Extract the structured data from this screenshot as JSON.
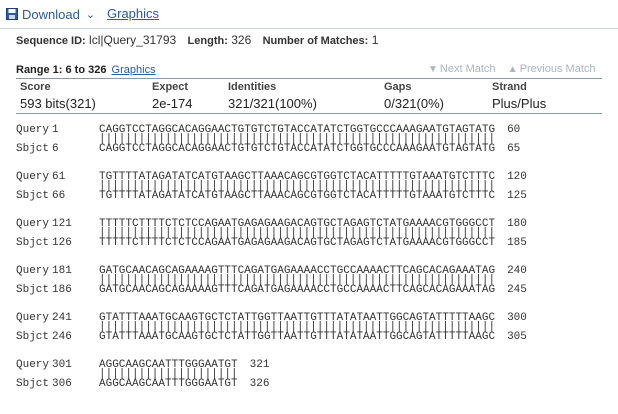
{
  "toolbar": {
    "download_label": "Download",
    "graphics_label": "Graphics"
  },
  "sequence": {
    "id_label": "Sequence ID:",
    "id_value": "lcl|Query_31793",
    "length_label": "Length:",
    "length_value": "326",
    "matches_label": "Number of Matches:",
    "matches_value": "1"
  },
  "range": {
    "label": "Range 1: 6 to 326",
    "graphics_link": "Graphics"
  },
  "nav": {
    "next_label": "Next Match",
    "prev_label": "Previous Match"
  },
  "stats": {
    "score_h": "Score",
    "score_v": "593 bits(321)",
    "expect_h": "Expect",
    "expect_v": "2e-174",
    "ident_h": "Identities",
    "ident_v": "321/321(100%)",
    "gaps_h": "Gaps",
    "gaps_v": "0/321(0%)",
    "strand_h": "Strand",
    "strand_v": "Plus/Plus"
  },
  "alignment": [
    {
      "q_label": "Query",
      "q_start": "1",
      "q_seq": "CAGGTCCTAGGCACAGGAACTGTGTCTGTACCATATCTGGTGCCCAAAGAATGTAGTATG",
      "q_end": "60",
      "match": "||||||||||||||||||||||||||||||||||||||||||||||||||||||||||||",
      "s_label": "Sbjct",
      "s_start": "6",
      "s_seq": "CAGGTCCTAGGCACAGGAACTGTGTCTGTACCATATCTGGTGCCCAAAGAATGTAGTATG",
      "s_end": "65"
    },
    {
      "q_label": "Query",
      "q_start": "61",
      "q_seq": "TGTTTTATAGATATCATGTAAGCTTAAACAGCGTGGTCTACATTTTTGTAAATGTCTTTC",
      "q_end": "120",
      "match": "||||||||||||||||||||||||||||||||||||||||||||||||||||||||||||",
      "s_label": "Sbjct",
      "s_start": "66",
      "s_seq": "TGTTTTATAGATATCATGTAAGCTTAAACAGCGTGGTCTACATTTTTGTAAATGTCTTTC",
      "s_end": "125"
    },
    {
      "q_label": "Query",
      "q_start": "121",
      "q_seq": "TTTTTCTTTTCTCTCCAGAATGAGAGAAGACAGTGCTAGAGTCTATGAAAACGTGGGCCT",
      "q_end": "180",
      "match": "||||||||||||||||||||||||||||||||||||||||||||||||||||||||||||",
      "s_label": "Sbjct",
      "s_start": "126",
      "s_seq": "TTTTTCTTTTCTCTCCAGAATGAGAGAAGACAGTGCTAGAGTCTATGAAAACGTGGGCCT",
      "s_end": "185"
    },
    {
      "q_label": "Query",
      "q_start": "181",
      "q_seq": "GATGCAACAGCAGAAAAGTTTCAGATGAGAAAACCTGCCAAAACTTCAGCACAGAAATAG",
      "q_end": "240",
      "match": "||||||||||||||||||||||||||||||||||||||||||||||||||||||||||||",
      "s_label": "Sbjct",
      "s_start": "186",
      "s_seq": "GATGCAACAGCAGAAAAGTTTCAGATGAGAAAACCTGCCAAAACTTCAGCACAGAAATAG",
      "s_end": "245"
    },
    {
      "q_label": "Query",
      "q_start": "241",
      "q_seq": "GTATTTAAATGCAAGTGCTCTATTGGTTAATTGTTTATATAATTGGCAGTATTTTTAAGC",
      "q_end": "300",
      "match": "||||||||||||||||||||||||||||||||||||||||||||||||||||||||||||",
      "s_label": "Sbjct",
      "s_start": "246",
      "s_seq": "GTATTTAAATGCAAGTGCTCTATTGGTTAATTGTTTATATAATTGGCAGTATTTTTAAGC",
      "s_end": "305"
    },
    {
      "q_label": "Query",
      "q_start": "301",
      "q_seq": "AGGCAAGCAATTTGGGAATGT",
      "q_end": "321",
      "match": "|||||||||||||||||||||",
      "s_label": "Sbjct",
      "s_start": "306",
      "s_seq": "AGGCAAGCAATTTGGGAATGT",
      "s_end": "326"
    }
  ],
  "colors": {
    "link": "#2a5a9a",
    "disabled": "#aab4c4",
    "rule": "#8a9aaa"
  }
}
